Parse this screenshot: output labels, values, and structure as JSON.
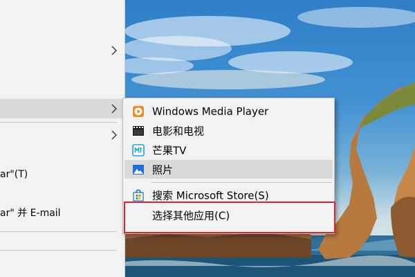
{
  "colors": {
    "menu_bg": "#f2f2f2",
    "hover_bg": "#dadada",
    "separator": "#c8c8c8",
    "highlight_border": "#d9262b",
    "wmp_icon": "#f08a24",
    "mango_icon": "#1ea0e6",
    "photos_icon": "#1f6fd8",
    "store_icon": "#0b72c9"
  },
  "main_menu": {
    "items": [
      {
        "label": "",
        "has_submenu": true
      },
      {
        "label": "",
        "has_submenu": true,
        "active": true
      },
      {
        "label": "",
        "has_submenu": true
      },
      {
        "label": "ar\"(T)"
      },
      {
        "label": "ar\" 并 E-mail"
      }
    ]
  },
  "submenu": {
    "items": [
      {
        "label": "Windows Media Player",
        "icon": "windows-media-player-icon"
      },
      {
        "label": "电影和电视",
        "icon": "movies-tv-icon"
      },
      {
        "label": "芒果TV",
        "icon": "mango-tv-icon"
      },
      {
        "label": "照片",
        "icon": "photos-icon",
        "active": true
      }
    ],
    "store_item": {
      "label": "搜索 Microsoft Store(S)",
      "icon": "store-bag-icon"
    },
    "choose_item": {
      "label": "选择其他应用(C)"
    }
  }
}
